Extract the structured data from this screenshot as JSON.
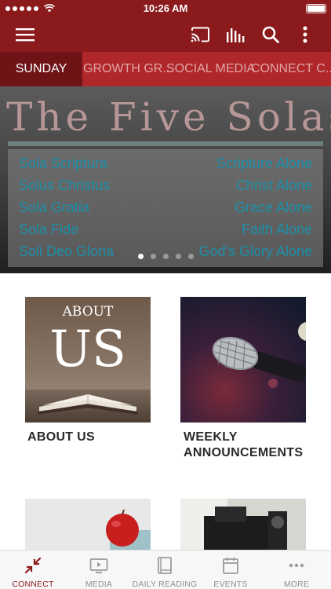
{
  "status_bar": {
    "time": "10:26 AM"
  },
  "app_bar": {
    "menu_icon": "hamburger-menu-icon",
    "cast_icon": "cast-icon",
    "audio_icon": "audio-bars-icon",
    "search_icon": "search-icon",
    "more_icon": "more-vertical-icon"
  },
  "tabs": [
    {
      "label": "SUNDAY",
      "active": true
    },
    {
      "label": "GROWTH GR..."
    },
    {
      "label": "SOCIAL MEDIA"
    },
    {
      "label": "CONNECT C..."
    }
  ],
  "hero": {
    "title": "The Five Solas",
    "rows": [
      {
        "latin": "Sola Scriptura",
        "english": "Scripture Alone"
      },
      {
        "latin": "Solus Christus",
        "english": "Christ Alone"
      },
      {
        "latin": "Sola Gratia",
        "english": "Grace Alone"
      },
      {
        "latin": "Sola Fide",
        "english": "Faith Alone"
      },
      {
        "latin": "Soli Deo Gloria",
        "english": "God's Glory Alone"
      }
    ],
    "page_count": 5,
    "current_page": 1
  },
  "cards": [
    {
      "label": "ABOUT US",
      "image_line1": "ABOUT",
      "image_line2": "US"
    },
    {
      "label": "WEEKLY ANNOUNCEMENTS"
    },
    {
      "label": ""
    },
    {
      "label": ""
    }
  ],
  "bottom_nav": [
    {
      "label": "CONNECT",
      "icon": "connect-arrows-icon",
      "active": true
    },
    {
      "label": "MEDIA",
      "icon": "media-play-icon"
    },
    {
      "label": "DAILY READING",
      "icon": "book-icon"
    },
    {
      "label": "EVENTS",
      "icon": "calendar-icon"
    },
    {
      "label": "MORE",
      "icon": "more-horizontal-icon"
    }
  ],
  "colors": {
    "brand": "#8b1a1d",
    "tab_bar": "#b0272a",
    "tab_active": "#6e1316",
    "sola_text": "#1d8fa8"
  }
}
